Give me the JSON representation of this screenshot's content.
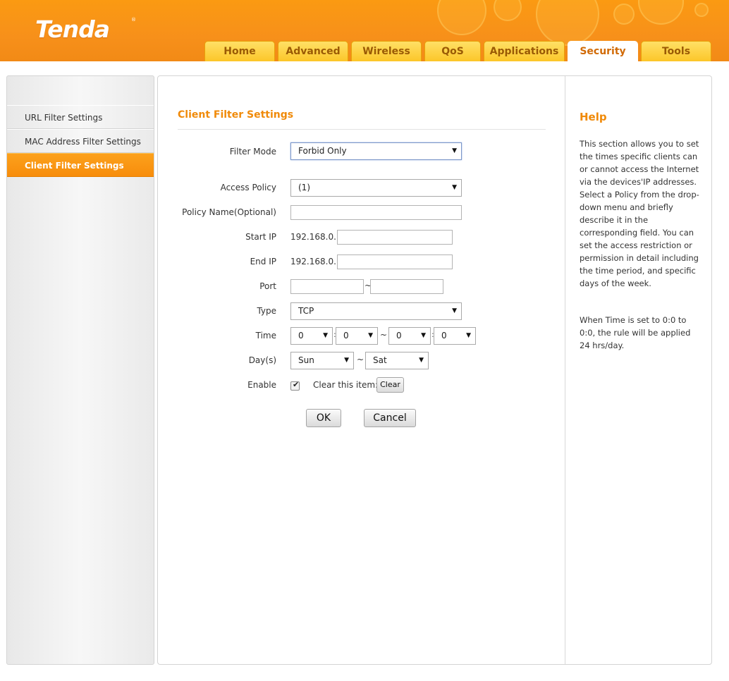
{
  "header": {
    "logo_text": "Tenda",
    "logo_reg": "®",
    "tabs": [
      {
        "label": "Home"
      },
      {
        "label": "Advanced"
      },
      {
        "label": "Wireless"
      },
      {
        "label": "QoS"
      },
      {
        "label": "Applications"
      },
      {
        "label": "Security",
        "active": true
      },
      {
        "label": "Tools"
      }
    ]
  },
  "sidebar": {
    "items": [
      {
        "label": "URL Filter Settings"
      },
      {
        "label": "MAC Address Filter Settings"
      },
      {
        "label": "Client Filter Settings",
        "active": true
      }
    ]
  },
  "main": {
    "title": "Client Filter Settings",
    "filter_mode": {
      "label": "Filter Mode",
      "value": "Forbid Only"
    },
    "access_policy": {
      "label": "Access Policy",
      "value": "(1)"
    },
    "policy_name": {
      "label": "Policy Name(Optional)",
      "value": ""
    },
    "start_ip": {
      "label": "Start IP",
      "prefix": "192.168.0.",
      "value": ""
    },
    "end_ip": {
      "label": "End IP",
      "prefix": "192.168.0.",
      "value": ""
    },
    "port": {
      "label": "Port",
      "from": "",
      "separator": "~",
      "to": ""
    },
    "type": {
      "label": "Type",
      "value": "TCP"
    },
    "time": {
      "label": "Time",
      "start_hour": "0",
      "start_min": "0",
      "separator": "~",
      "end_hour": "0",
      "end_min": "0",
      "colon": ":"
    },
    "days": {
      "label": "Day(s)",
      "from": "Sun",
      "separator": "~",
      "to": "Sat"
    },
    "enable": {
      "label": "Enable",
      "checked": true,
      "clear_label": "Clear this item:",
      "clear_button": "Clear"
    },
    "ok_button": "OK",
    "cancel_button": "Cancel"
  },
  "help": {
    "title": "Help",
    "paragraph1": "This section allows you to set the times specific clients can or cannot access the Internet via the devices'IP addresses. Select a Policy from the drop-down menu and briefly describe it in the corresponding field. You can set the access restriction or permission in detail including the time period, and specific days of the week.",
    "paragraph2": "When Time is set to 0:0 to 0:0, the rule will be applied 24 hrs/day."
  },
  "colors": {
    "brand_orange": "#f7901a",
    "title_orange": "#f08a09",
    "tab_yellow": "#fcc629"
  },
  "icons": {
    "dropdown": "chevron-down-icon",
    "checkbox": "check-icon"
  }
}
